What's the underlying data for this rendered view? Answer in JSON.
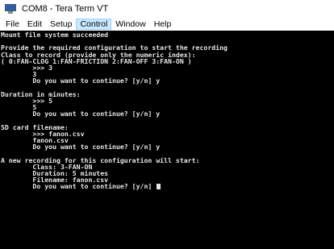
{
  "window": {
    "title": "COM8 - Tera Term VT"
  },
  "menu": [
    "File",
    "Edit",
    "Setup",
    "Control",
    "Window",
    "Help"
  ],
  "menu_active_index": 3,
  "terminal": {
    "lines": [
      "Mount file system succeeded",
      "",
      "Provide the required configuration to start the recording",
      "Class to record (provide only the numeric index):",
      "( 0:FAN-CLOG 1:FAN-FRICTION 2:FAN-OFF 3:FAN-ON )",
      "        >>> 3",
      "        3",
      "        Do you want to continue? [y/n] y",
      "",
      "Duration in minutes:",
      "        >>> 5",
      "        5",
      "        Do you want to continue? [y/n] y",
      "",
      "SD card filename:",
      "        >>> fanon.csv",
      "        fanon.csv",
      "        Do you want to continue? [y/n] y",
      "",
      "A new recording for this configuration will start:",
      "        Class: 3-FAN-ON",
      "        Duration: 5 minutes",
      "        Filename: fanon.csv",
      "        Do you want to continue? [y/n] "
    ]
  }
}
